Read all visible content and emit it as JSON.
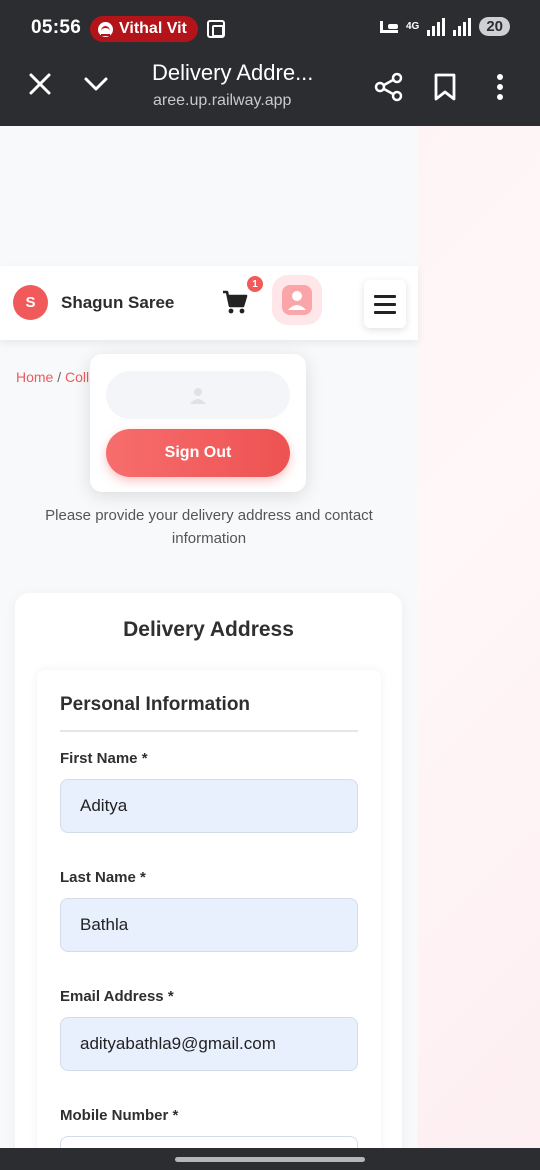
{
  "status_bar": {
    "time": "05:56",
    "media_pill": "Vithal Vit",
    "network": "4G",
    "battery": "20"
  },
  "browser": {
    "tab_title": "Delivery Addre...",
    "url": "aree.up.railway.app"
  },
  "navbar": {
    "logo_letter": "S",
    "brand": "Shagun Saree",
    "cart_count": "1"
  },
  "breadcrumb": {
    "home": "Home",
    "separator": "/",
    "current": "Coll"
  },
  "user_menu": {
    "sign_out": "Sign Out"
  },
  "subtitle": "Please provide your delivery address and contact information",
  "form": {
    "title": "Delivery Address",
    "section_title": "Personal Information",
    "first_name_label": "First Name *",
    "first_name_value": "Aditya",
    "last_name_label": "Last Name *",
    "last_name_value": "Bathla",
    "email_label": "Email Address *",
    "email_value": "adityabathla9@gmail.com",
    "mobile_label": "Mobile Number *",
    "mobile_value": ""
  },
  "colors": {
    "accent": "#f05a5a",
    "chrome": "#2b2d31",
    "field_fill": "#e8f0fd"
  }
}
